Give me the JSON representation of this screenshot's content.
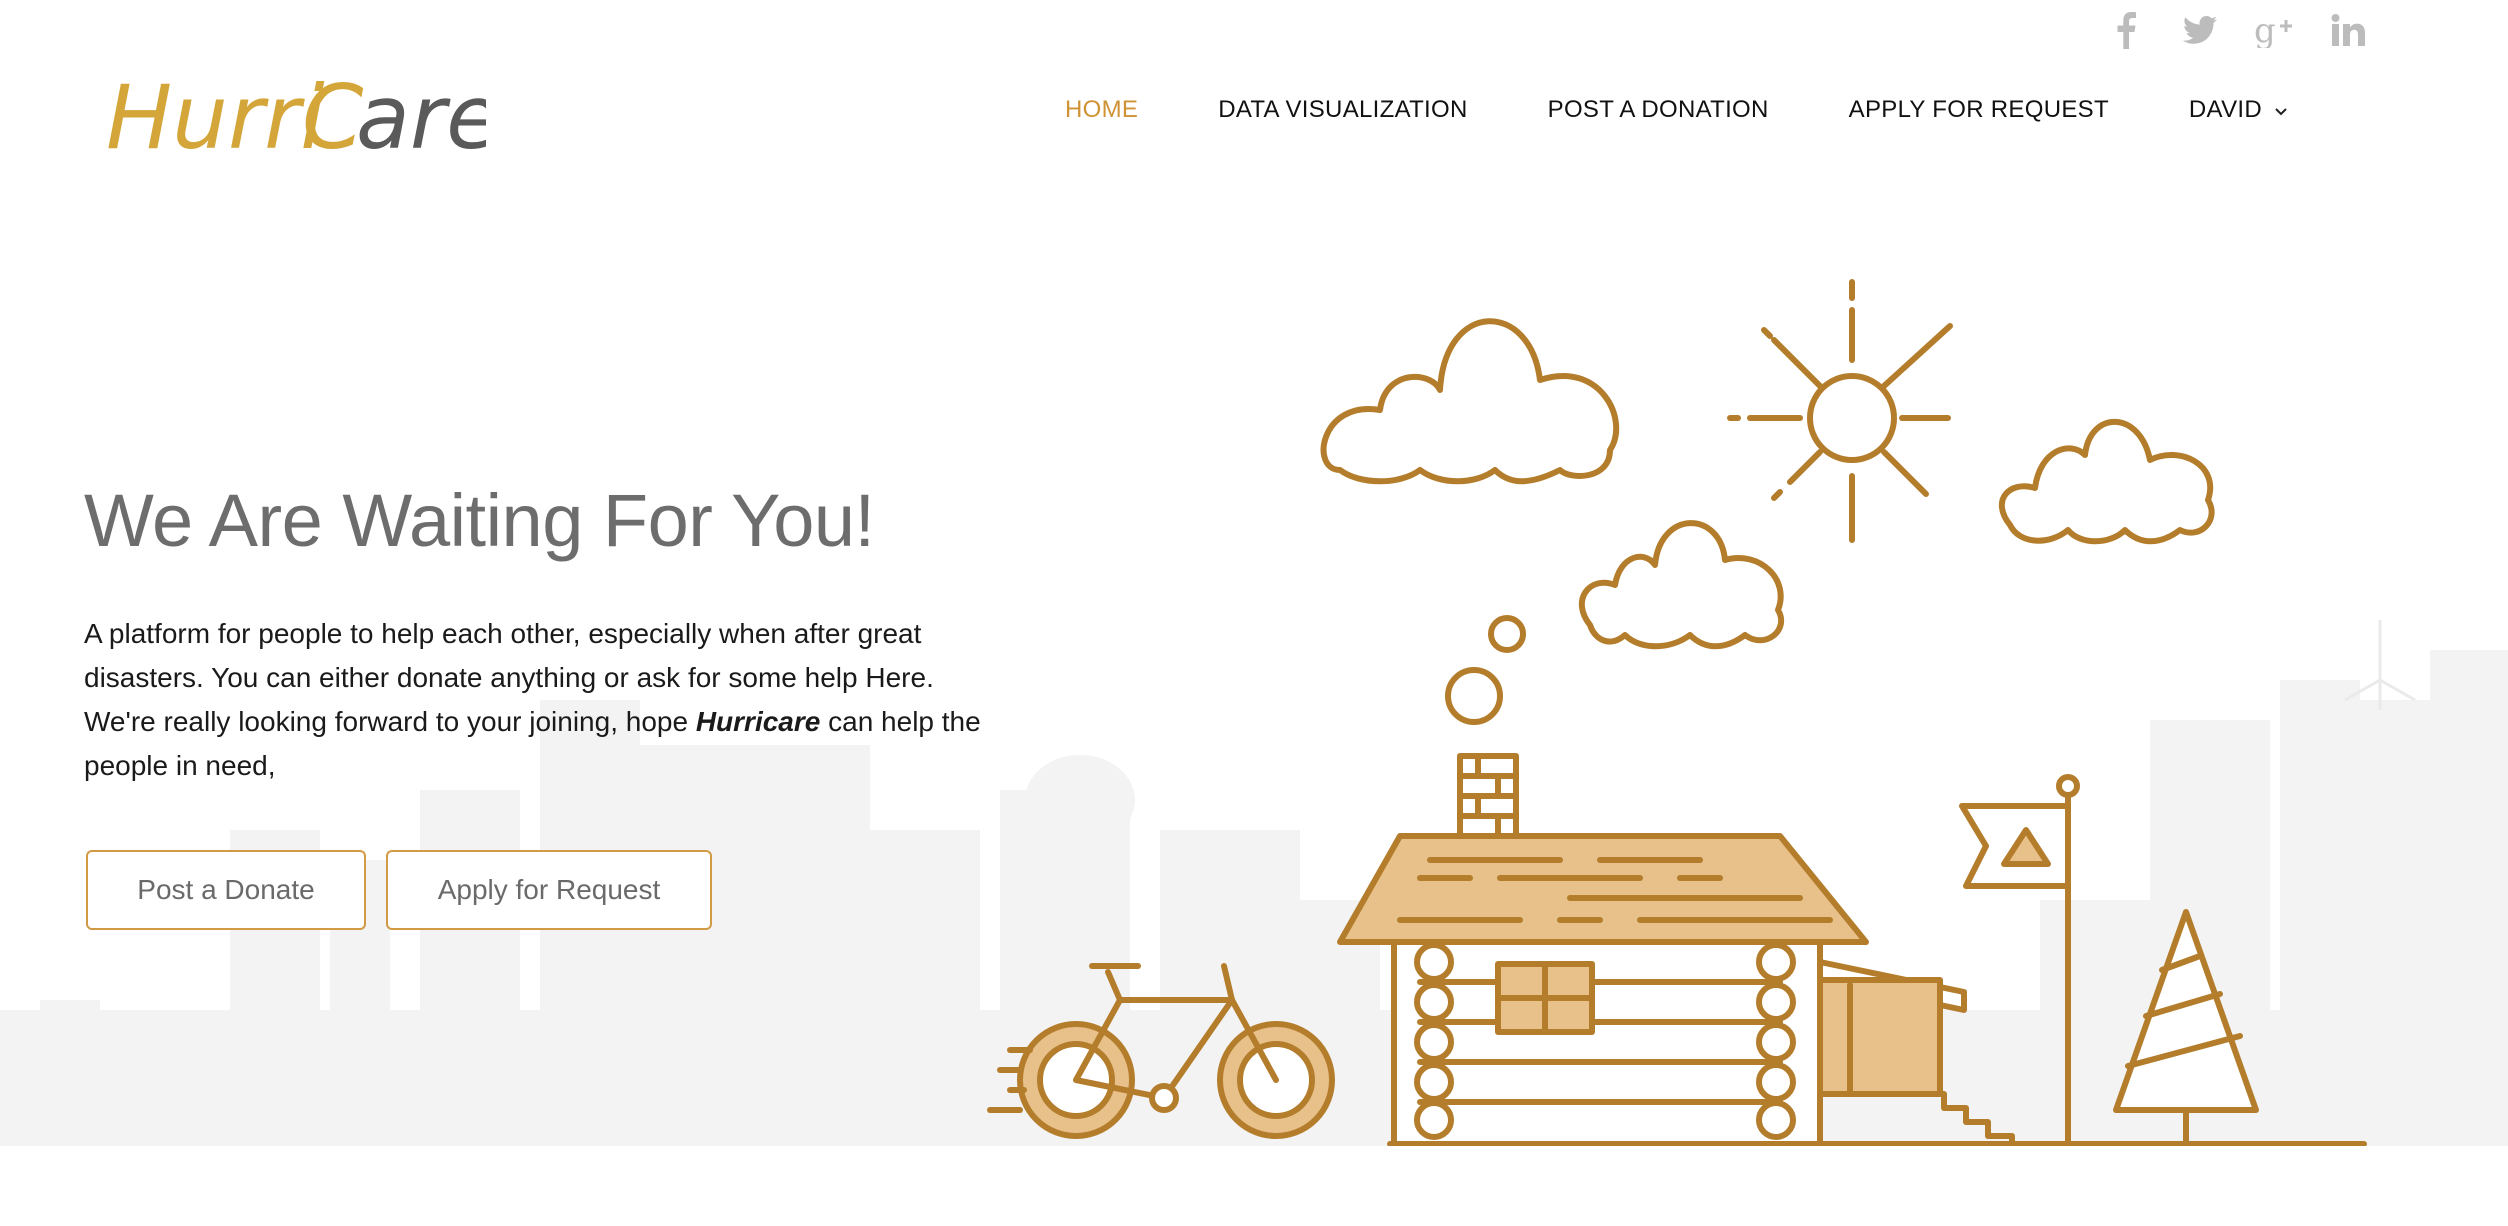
{
  "brand": {
    "logo_part1": "Hurri",
    "logo_part2": "C",
    "logo_part3": "are",
    "colors": {
      "accent": "#cf9336",
      "logo_dark": "#5a5a5a",
      "logo_gold": "#d4a63a",
      "illustration": "#b47d2c",
      "fill_light": "#e8c08a"
    }
  },
  "social": [
    {
      "name": "facebook",
      "icon": "facebook-icon"
    },
    {
      "name": "twitter",
      "icon": "twitter-icon"
    },
    {
      "name": "google-plus",
      "icon": "google-plus-icon"
    },
    {
      "name": "linkedin",
      "icon": "linkedin-icon"
    }
  ],
  "nav": {
    "items": [
      {
        "label": "HOME",
        "active": true
      },
      {
        "label": "DATA VISUALIZATION",
        "active": false
      },
      {
        "label": "POST A DONATION",
        "active": false
      },
      {
        "label": "APPLY FOR REQUEST",
        "active": false
      },
      {
        "label": "DAVID",
        "active": false,
        "dropdown": true
      }
    ]
  },
  "hero": {
    "title": "We Are Waiting For You!",
    "desc_before": "A platform for people to help each other, especially when after great disasters. You can either donate anything or ask for some help Here. We're really looking forward to your joining, hope ",
    "desc_emphasis": "Hurricare",
    "desc_after": "  can help the people in need,",
    "buttons": {
      "donate": "Post a Donate",
      "request": "Apply for Request"
    }
  }
}
